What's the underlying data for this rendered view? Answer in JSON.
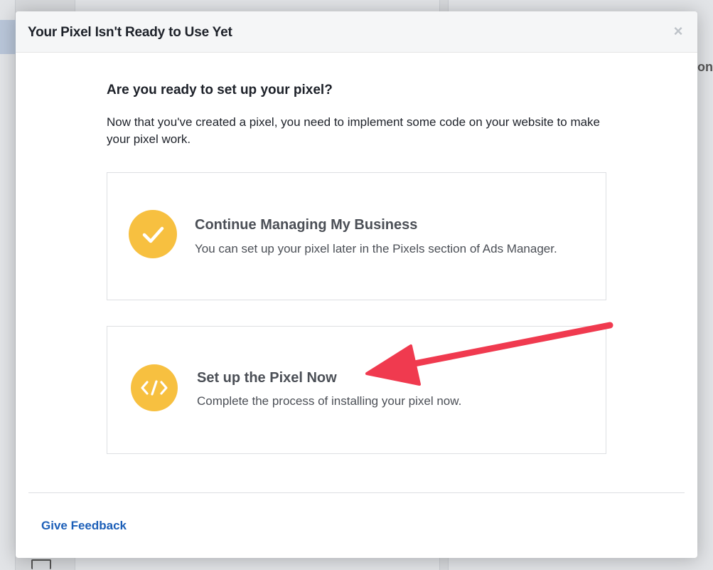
{
  "background": {
    "peek_text": "on"
  },
  "modal": {
    "title": "Your Pixel Isn't Ready to Use Yet",
    "close_glyph": "×",
    "heading": "Are you ready to set up your pixel?",
    "description": "Now that you've created a pixel, you need to implement some code on your website to make your pixel work.",
    "options": [
      {
        "title": "Continue Managing My Business",
        "subtitle": "You can set up your pixel later in the Pixels section of Ads Manager.",
        "icon": "checkmark-icon"
      },
      {
        "title": "Set up the Pixel Now",
        "subtitle": "Complete the process of installing your pixel now.",
        "icon": "code-icon"
      }
    ],
    "feedback_link": "Give Feedback"
  },
  "colors": {
    "accent_yellow": "#f7c040",
    "link_blue": "#1c5fb8",
    "annotation_red": "#f03a4f"
  }
}
